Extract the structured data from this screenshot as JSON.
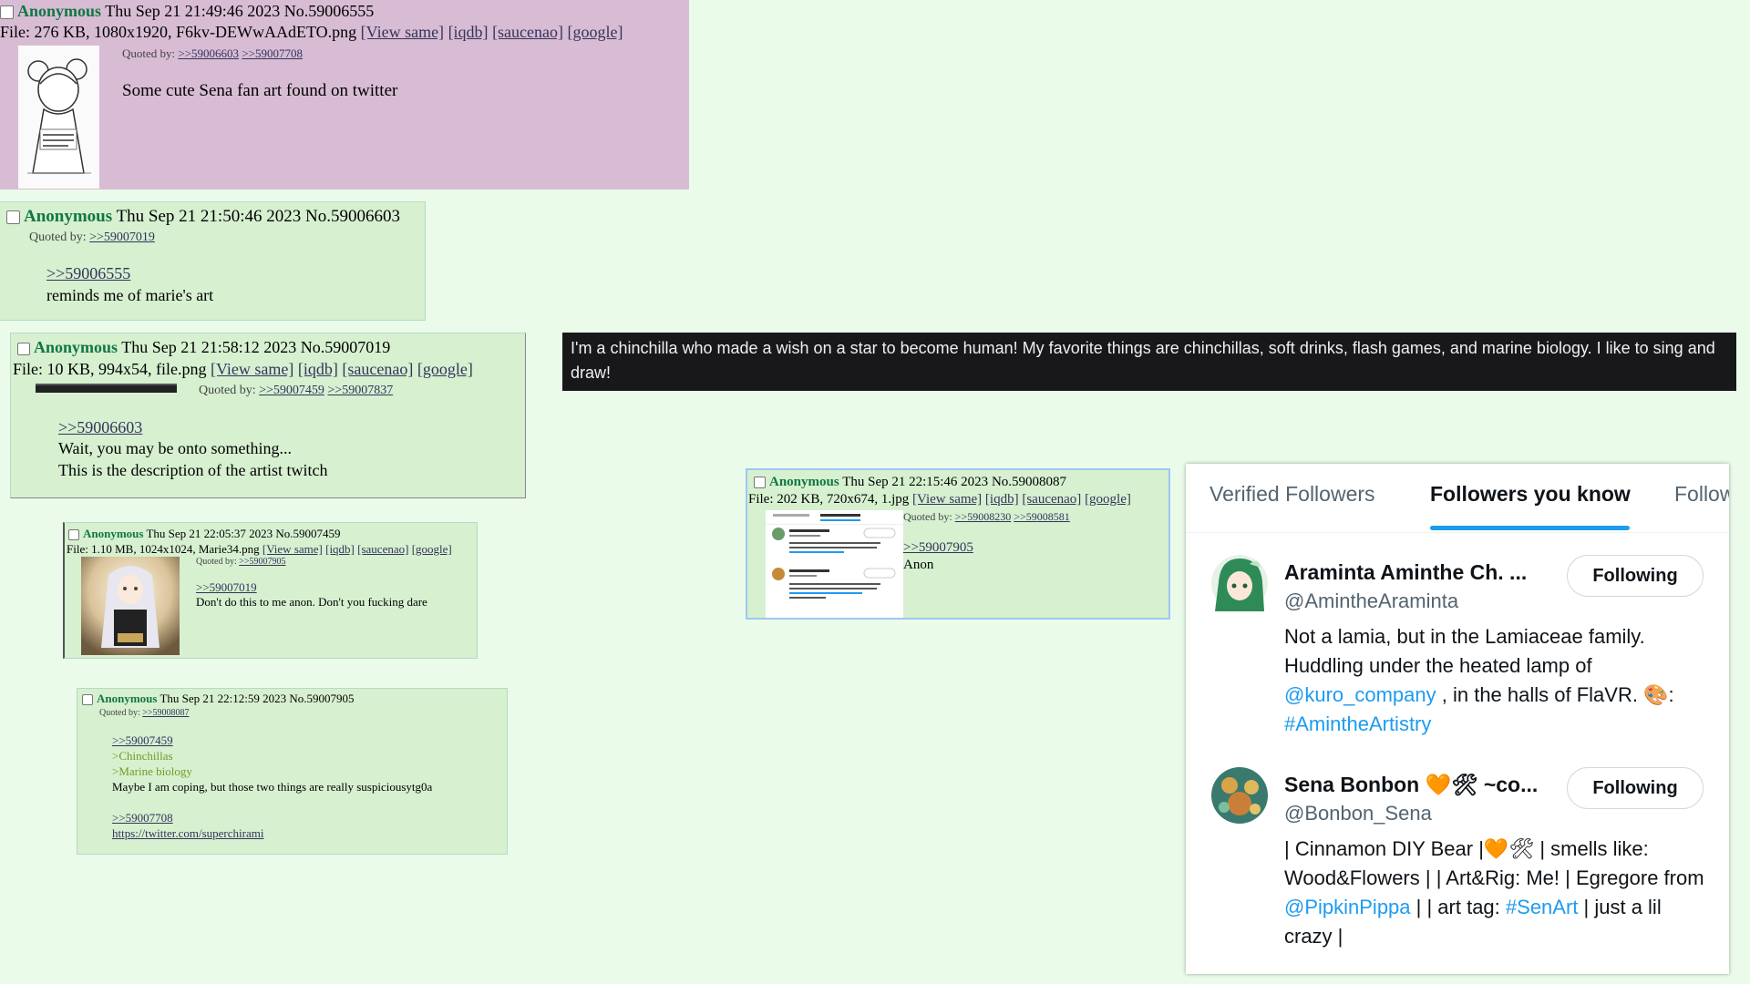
{
  "posts": [
    {
      "name": "Anonymous",
      "datetime": "Thu Sep 21 21:49:46 2023",
      "no": "No.59006555",
      "file_info": "File: 276 KB, 1080x1920, F6kv-DEWwAAdETO.png",
      "links": [
        "[View same]",
        "[iqdb]",
        "[saucenao]",
        "[google]"
      ],
      "quoted_by_label": "Quoted by:",
      "quoted_by": [
        ">>59006603",
        ">>59007708"
      ],
      "text": "Some cute Sena fan art found on twitter"
    },
    {
      "name": "Anonymous",
      "datetime": "Thu Sep 21 21:50:46 2023",
      "no": "No.59006603",
      "quoted_by_label": "Quoted by:",
      "quoted_by": [
        ">>59007019"
      ],
      "quote_link": ">>59006555",
      "text": "reminds me of marie's art"
    },
    {
      "name": "Anonymous",
      "datetime": "Thu Sep 21 21:58:12 2023",
      "no": "No.59007019",
      "file_info": "File: 10 KB, 994x54, file.png",
      "links": [
        "[View same]",
        "[iqdb]",
        "[saucenao]",
        "[google]"
      ],
      "quoted_by_label": "Quoted by:",
      "quoted_by": [
        ">>59007459",
        ">>59007837"
      ],
      "quote_link": ">>59006603",
      "lines": [
        "Wait, you may be onto something...",
        "This is the description of the artist twitch"
      ]
    },
    {
      "name": "Anonymous",
      "datetime": "Thu Sep 21 22:05:37 2023",
      "no": "No.59007459",
      "file_info": "File: 1.10 MB, 1024x1024, Marie34.png",
      "links": [
        "[View same]",
        "[iqdb]",
        "[saucenao]",
        "[google]"
      ],
      "quoted_by_label": "Quoted by:",
      "quoted_by": [
        ">>59007905"
      ],
      "quote_link": ">>59007019",
      "text": "Don't do this to me anon. Don't you fucking dare"
    },
    {
      "name": "Anonymous",
      "datetime": "Thu Sep 21 22:12:59 2023",
      "no": "No.59007905",
      "quoted_by_label": "Quoted by:",
      "quoted_by": [
        ">>59008087"
      ],
      "quote_link": ">>59007459",
      "greentext": [
        ">Chinchillas",
        ">Marine biology"
      ],
      "text": "Maybe I am coping, but those two things are really suspiciousytg0a",
      "quote_link2": ">>59007708",
      "url": "https://twitter.com/superchirami"
    },
    {
      "name": "Anonymous",
      "datetime": "Thu Sep 21 22:15:46 2023",
      "no": "No.59008087",
      "file_info": "File: 202 KB, 720x674, 1.jpg",
      "links": [
        "[View same]",
        "[iqdb]",
        "[saucenao]",
        "[google]"
      ],
      "quoted_by_label": "Quoted by:",
      "quoted_by": [
        ">>59008230",
        ">>59008581"
      ],
      "quote_link": ">>59007905",
      "text": "Anon"
    }
  ],
  "twitch_description": "I'm a chinchilla who made a wish on a star to become human! My favorite things are chinchillas, soft drinks, flash games, and marine biology. I like to sing and draw!",
  "twitter": {
    "tabs": [
      "Verified Followers",
      "Followers you know",
      "Follow"
    ],
    "users": [
      {
        "name": "Araminta Aminthe Ch. ...",
        "handle": "@AmintheAraminta",
        "button": "Following",
        "bio": {
          "t1": "Not a lamia, but in the Lamiaceae family. Huddling under the heated lamp of ",
          "l1": "@kuro_company",
          "t2": " , in the halls of FlaVR. 🎨: ",
          "l2": "#AmintheArtistry"
        }
      },
      {
        "name": "Sena Bonbon 🧡🛠 ~co...",
        "handle": "@Bonbon_Sena",
        "button": "Following",
        "bio": {
          "t1": "| Cinnamon DIY Bear |🧡🛠 | smells like: Wood&Flowers | | Art&Rig: Me! | Egregore from ",
          "l1": "@PipkinPippa",
          "t2": " | | art tag: ",
          "l2": "#SenArt",
          "t3": " | just a lil crazy |"
        }
      }
    ]
  },
  "colors": {
    "page_bg": "#eafbea",
    "post_bg": "#d6f0d0",
    "op_bg": "#d8bcd4",
    "name": "#117743",
    "link": "#34345c",
    "greentext": "#789922",
    "twitch_bg": "#18181b",
    "twitter_blue": "#1d9bf0"
  }
}
